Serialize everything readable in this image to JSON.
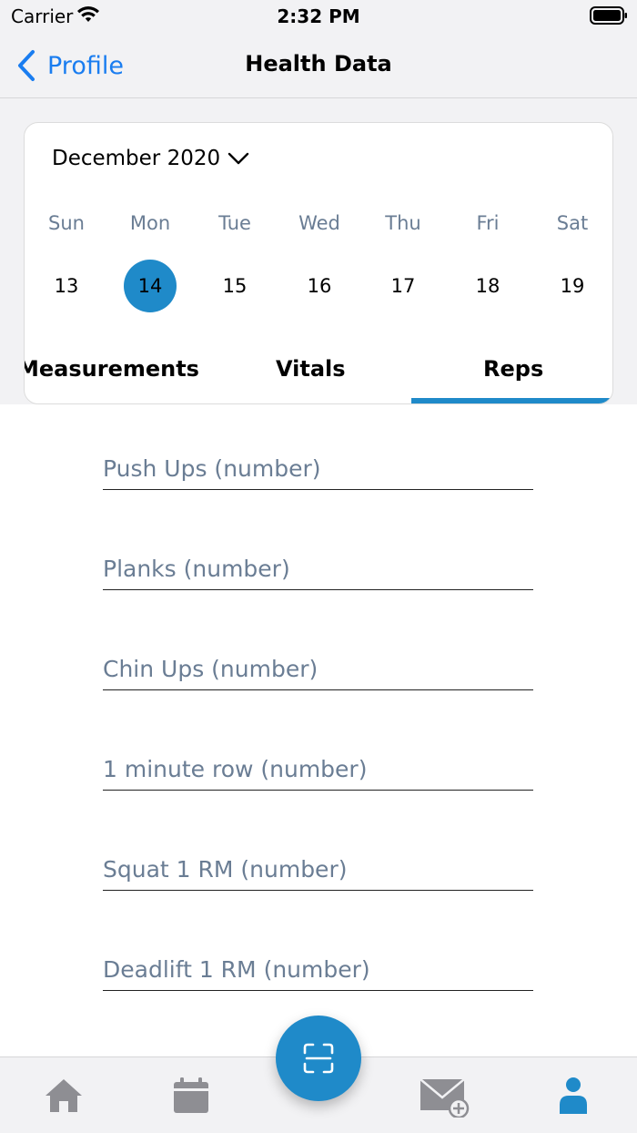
{
  "status_bar": {
    "carrier": "Carrier",
    "time": "2:32 PM"
  },
  "nav": {
    "back_label": "Profile",
    "title": "Health Data"
  },
  "calendar": {
    "month_label": "December 2020",
    "weekdays": [
      "Sun",
      "Mon",
      "Tue",
      "Wed",
      "Thu",
      "Fri",
      "Sat"
    ],
    "dates": [
      "13",
      "14",
      "15",
      "16",
      "17",
      "18",
      "19"
    ],
    "selected_date": "14"
  },
  "tabs": {
    "measurements": "Measurements",
    "vitals": "Vitals",
    "reps": "Reps",
    "active": "Reps"
  },
  "form": {
    "fields": [
      {
        "placeholder": "Push Ups (number)",
        "value": ""
      },
      {
        "placeholder": "Planks (number)",
        "value": ""
      },
      {
        "placeholder": "Chin Ups (number)",
        "value": ""
      },
      {
        "placeholder": "1 minute row (number)",
        "value": ""
      },
      {
        "placeholder": "Squat 1 RM (number)",
        "value": ""
      },
      {
        "placeholder": "Deadlift 1 RM (number)",
        "value": ""
      }
    ]
  },
  "tab_bar": {
    "items": [
      "home-icon",
      "calendar-icon",
      "scan-icon",
      "mail-add-icon",
      "person-icon"
    ],
    "active": "person-icon"
  },
  "colors": {
    "accent": "#1f8ac9",
    "link": "#1a7df0",
    "muted_text": "#6a7d94",
    "inactive_icon": "#8e8e93",
    "bar_background": "#f2f2f4"
  }
}
